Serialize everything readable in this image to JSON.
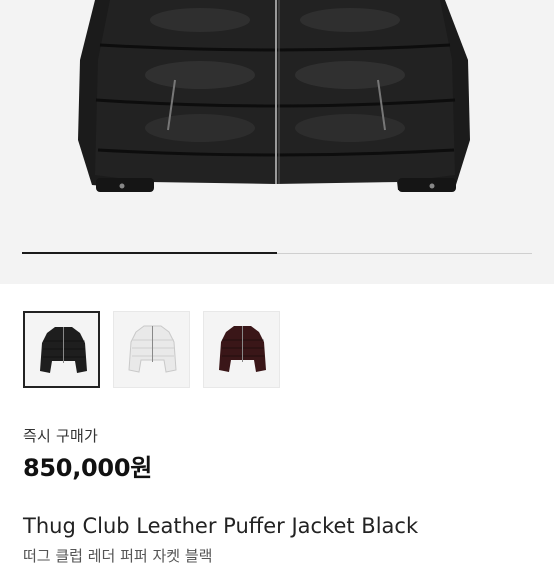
{
  "gallery": {
    "progress_fraction": 0.5,
    "thumbnails": [
      {
        "name": "black",
        "color": "#1e1e1e",
        "selected": true
      },
      {
        "name": "white",
        "color": "#e9e9e9",
        "selected": false
      },
      {
        "name": "burgundy",
        "color": "#3a1618",
        "selected": false
      }
    ]
  },
  "listing": {
    "purchase_label": "즉시 구매가",
    "price": "850,000원",
    "title": "Thug Club Leather Puffer Jacket Black",
    "subtitle": "떠그 클럽 레더 퍼퍼 자켓 블랙"
  }
}
